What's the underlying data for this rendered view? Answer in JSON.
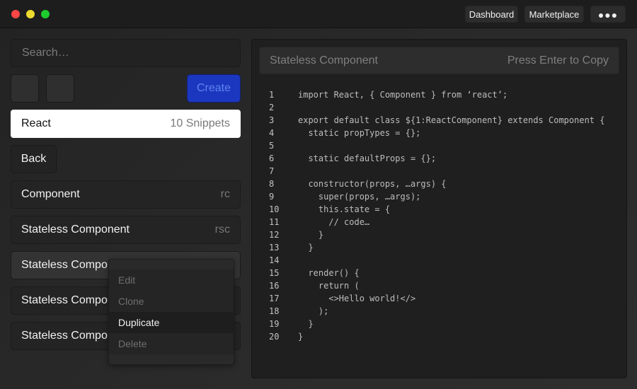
{
  "titlebar": {
    "buttons": {
      "dashboard": "Dashboard",
      "marketplace": "Marketplace",
      "more": "●●●"
    },
    "traffic_colors": {
      "close": "#fc4545",
      "minimize": "#eedb2f",
      "zoom": "#1dcd2d"
    }
  },
  "sidebar": {
    "search_placeholder": "Search…",
    "create_label": "Create",
    "category": {
      "name": "React",
      "count": "10 Snippets"
    },
    "back_label": "Back",
    "snippets": [
      {
        "name": "Component",
        "shortcut": "rc"
      },
      {
        "name": "Stateless Component",
        "shortcut": "rsc"
      },
      {
        "name": "Stateless Component",
        "shortcut": ""
      },
      {
        "name": "Stateless Component",
        "shortcut": ""
      },
      {
        "name": "Stateless Component",
        "shortcut": ""
      }
    ]
  },
  "context_menu": {
    "items": [
      {
        "label": "Edit",
        "enabled": false
      },
      {
        "label": "Clone",
        "enabled": false
      },
      {
        "label": "Duplicate",
        "enabled": true
      },
      {
        "label": "Delete",
        "enabled": false
      }
    ]
  },
  "editor": {
    "title": "Stateless Component",
    "hint": "Press Enter to Copy",
    "lines": [
      "import React, { Component } from ‘react’;",
      "",
      "export default class ${1:ReactComponent} extends Component {",
      "  static propTypes = {};",
      "",
      "  static defaultProps = {};",
      "",
      "  constructor(props, …args) {",
      "    super(props, …args);",
      "    this.state = {",
      "      // code…",
      "    }",
      "  }",
      "",
      "  render() {",
      "    return (",
      "      <>Hello world!</>",
      "    );",
      "  }",
      "}"
    ]
  },
  "colors": {
    "accent": "#1c37bf",
    "accent_text": "#5d85ee"
  }
}
